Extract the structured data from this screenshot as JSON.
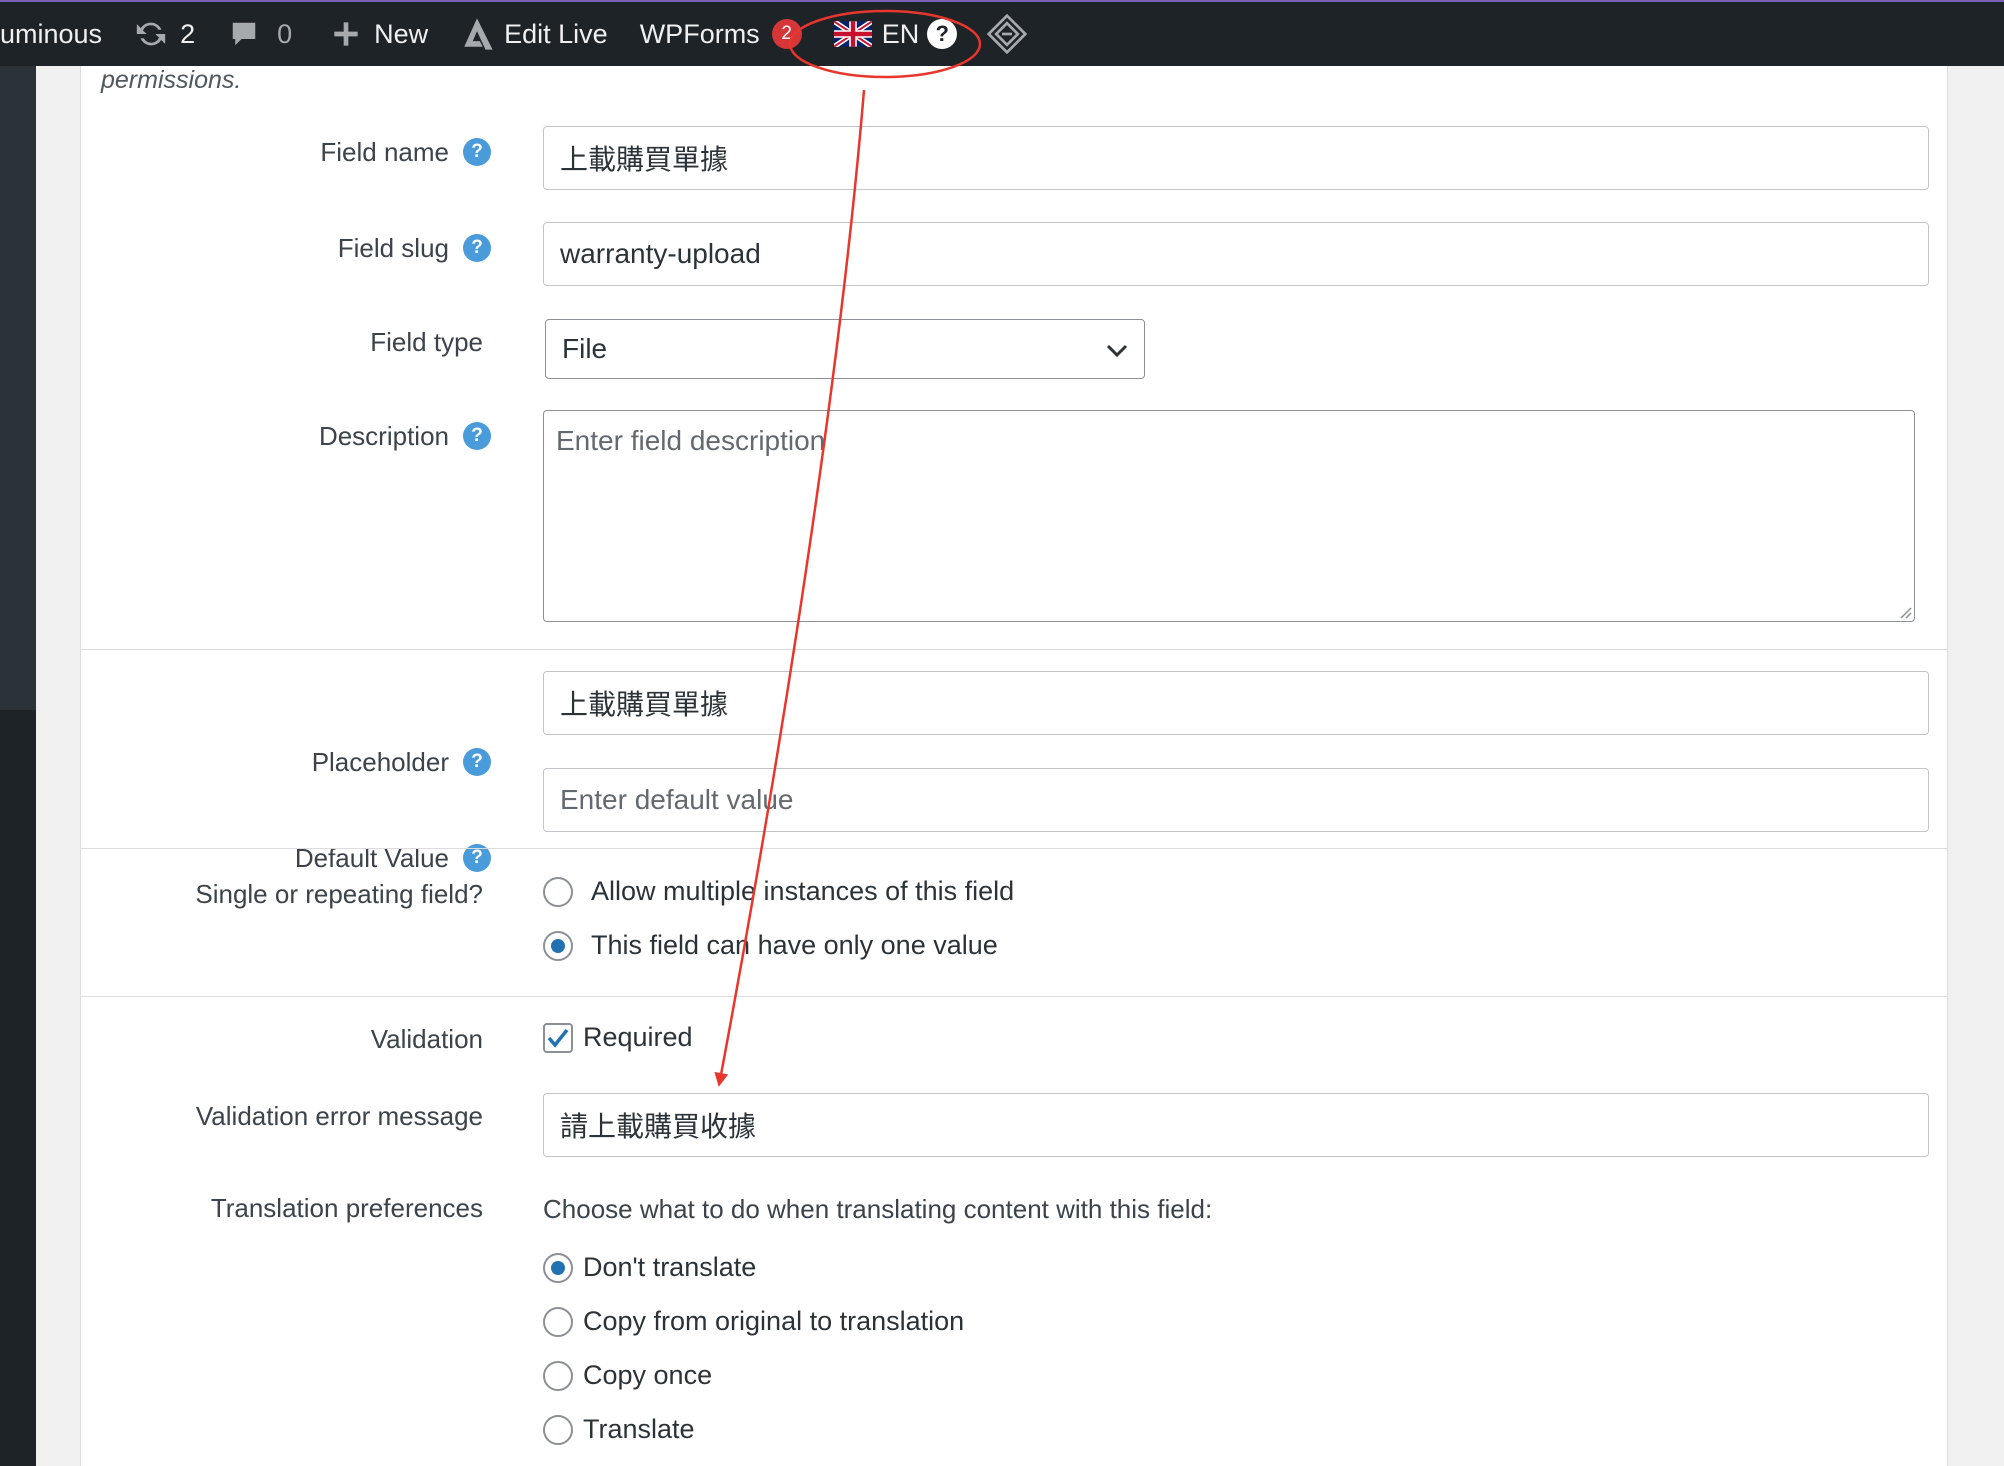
{
  "admin_bar": {
    "site_name": "uminous",
    "updates_count": "2",
    "comments_count": "0",
    "new_label": "New",
    "edit_live_label": "Edit Live",
    "wpforms_label": "WPForms",
    "wpforms_badge": "2",
    "language_label": "EN",
    "help_glyph": "?"
  },
  "intro_text": "permissions.",
  "fields": {
    "field_name": {
      "label": "Field name",
      "value": "上載購買單據"
    },
    "field_slug": {
      "label": "Field slug",
      "value": "warranty-upload"
    },
    "field_type": {
      "label": "Field type",
      "value": "File"
    },
    "description": {
      "label": "Description",
      "placeholder": "Enter field description"
    },
    "placeholder": {
      "label": "Placeholder",
      "value": "上載購買單據"
    },
    "default_value": {
      "label": "Default Value",
      "placeholder": "Enter default value"
    },
    "repeating": {
      "label": "Single or repeating field?",
      "options": [
        "Allow multiple instances of this field",
        "This field can have only one value"
      ],
      "selected": 1
    },
    "validation": {
      "label": "Validation",
      "checkbox_label": "Required",
      "checked": true
    },
    "validation_error": {
      "label": "Validation error message",
      "value": "請上載購買收據"
    },
    "translation": {
      "label": "Translation preferences",
      "intro": "Choose what to do when translating content with this field:",
      "options": [
        "Don't translate",
        "Copy from original to translation",
        "Copy once",
        "Translate"
      ],
      "selected": 0
    }
  },
  "help_glyph": "?",
  "colors": {
    "admin_bar_bg": "#1d2327",
    "accent": "#2271b1",
    "help_icon": "#4a9bd9",
    "badge": "#d63638",
    "annotation": "#e8362d"
  }
}
